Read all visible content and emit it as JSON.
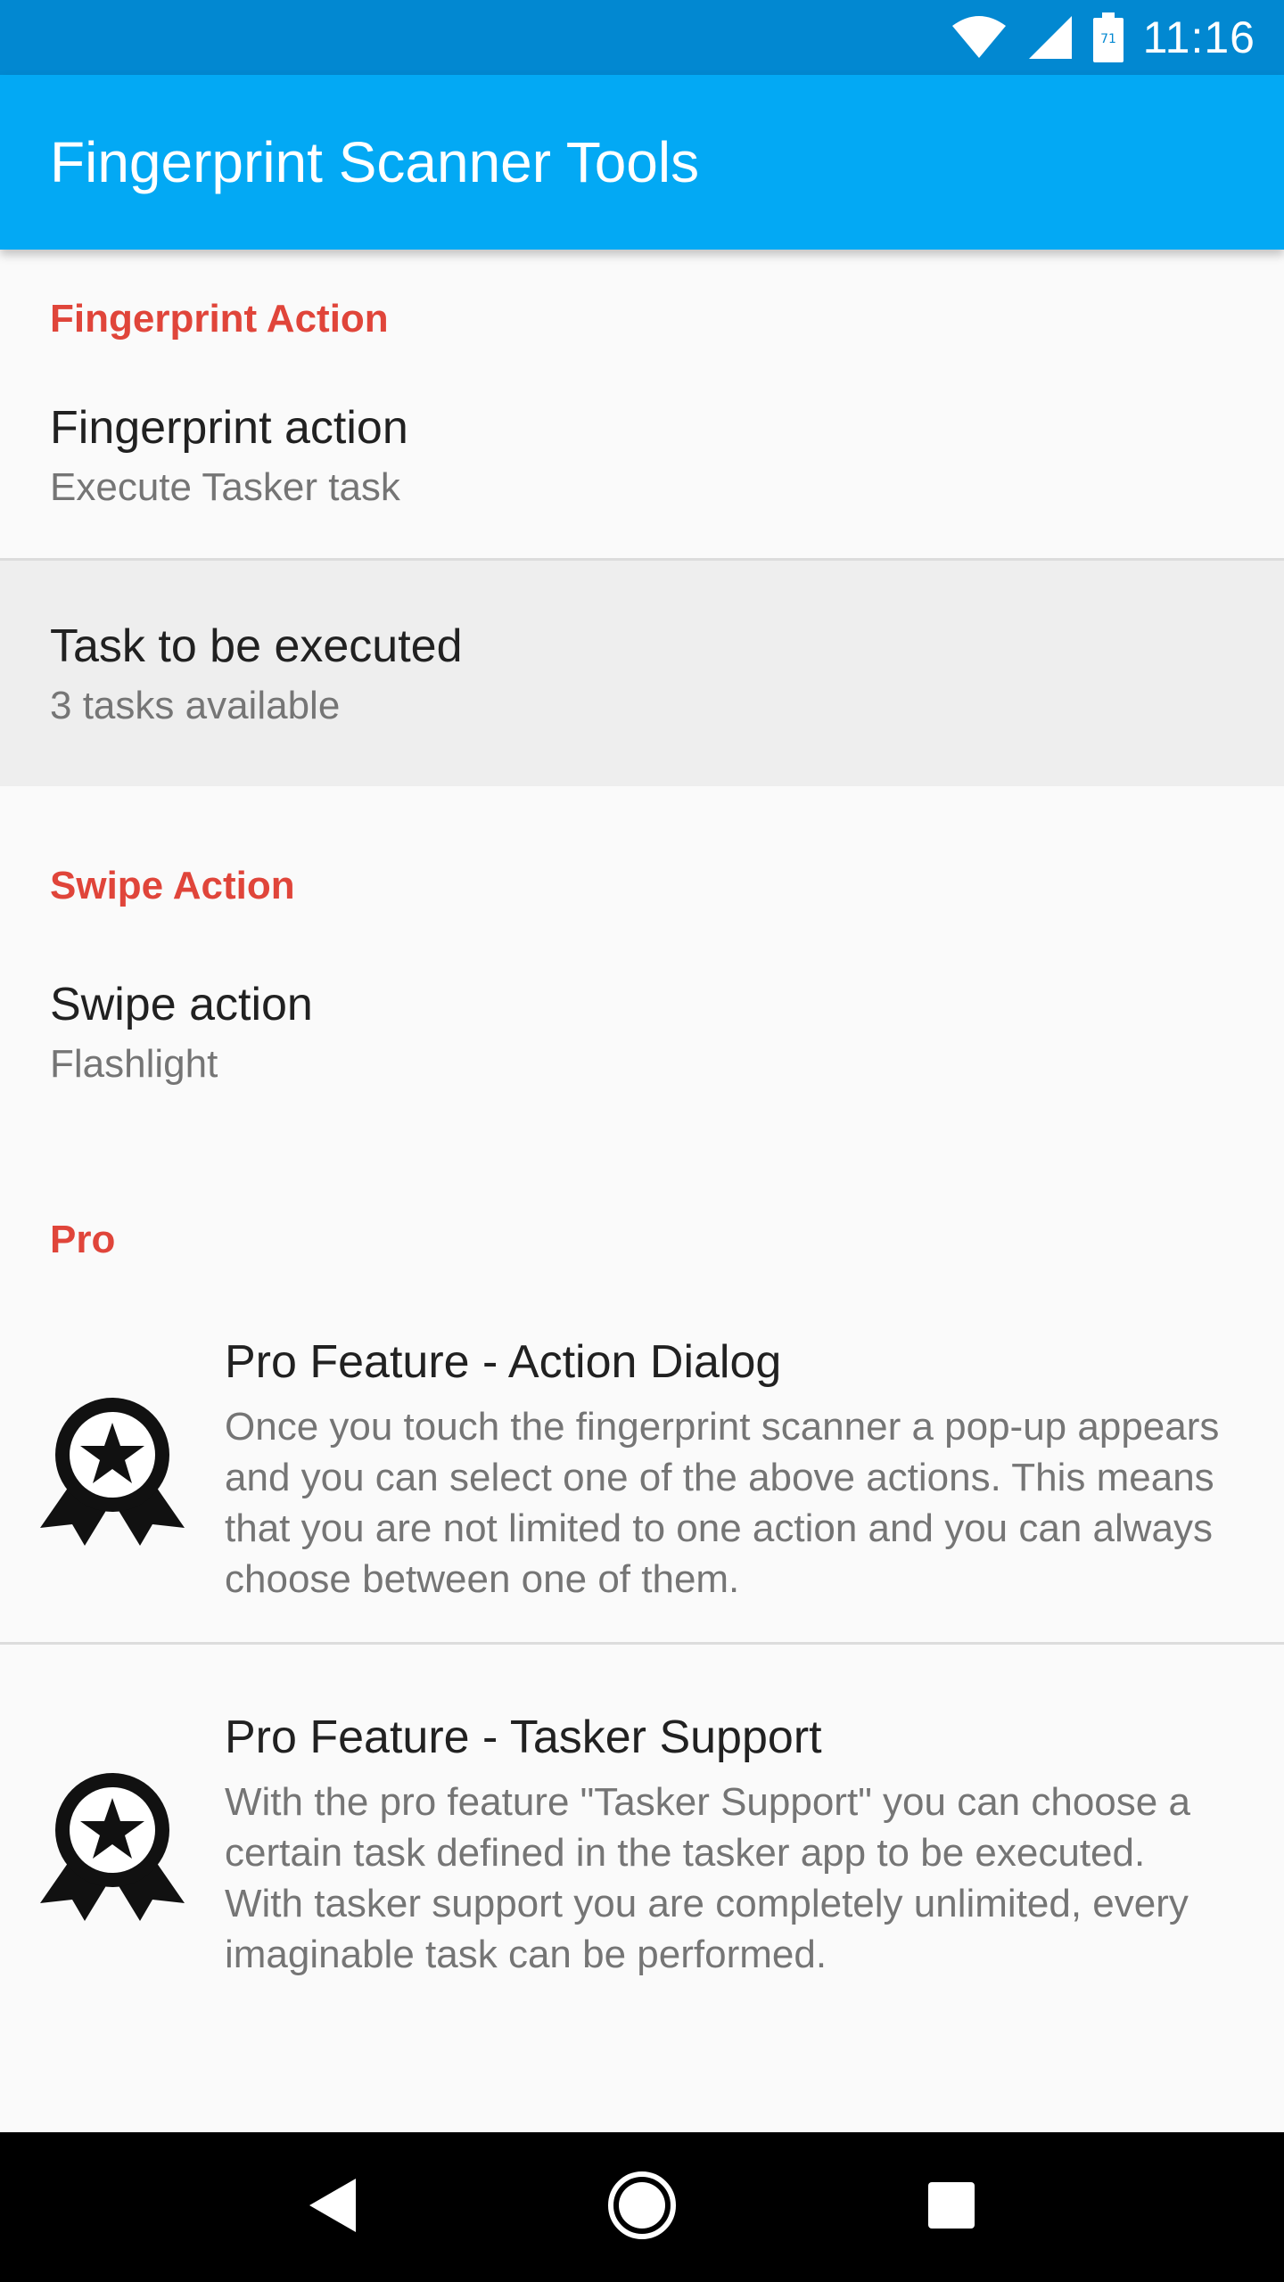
{
  "status_bar": {
    "time": "11:16",
    "icons": [
      "wifi-icon",
      "cell-signal-icon",
      "battery-icon"
    ],
    "battery_level": "71"
  },
  "app_bar": {
    "title": "Fingerprint Scanner Tools"
  },
  "sections": {
    "fingerprint": {
      "header": "Fingerprint Action",
      "items": [
        {
          "title": "Fingerprint action",
          "summary": "Execute Tasker task"
        },
        {
          "title": "Task to be executed",
          "summary": "3 tasks available"
        }
      ]
    },
    "swipe": {
      "header": "Swipe Action",
      "items": [
        {
          "title": "Swipe action",
          "summary": "Flashlight"
        }
      ]
    },
    "pro": {
      "header": "Pro",
      "items": [
        {
          "title": "Pro Feature - Action Dialog",
          "summary": "Once you touch the fingerprint scanner a pop-up appears and you can select one of the above actions. This means that you are not limited to one action and you can always choose between one of them.",
          "icon": "award-ribbon-icon"
        },
        {
          "title": "Pro Feature - Tasker Support",
          "summary": "With the pro feature \"Tasker Support\" you can choose a certain task defined in the tasker app to be executed. With tasker support you are completely unlimited, every imaginable task can be performed.",
          "icon": "award-ribbon-icon"
        }
      ]
    }
  },
  "nav_bar": {
    "buttons": [
      "back-icon",
      "home-icon",
      "recents-icon"
    ]
  },
  "colors": {
    "status_bar": "#0288d1",
    "app_bar": "#03a9f4",
    "category_accent": "#e0453a",
    "selected_row": "#eeeeee"
  }
}
